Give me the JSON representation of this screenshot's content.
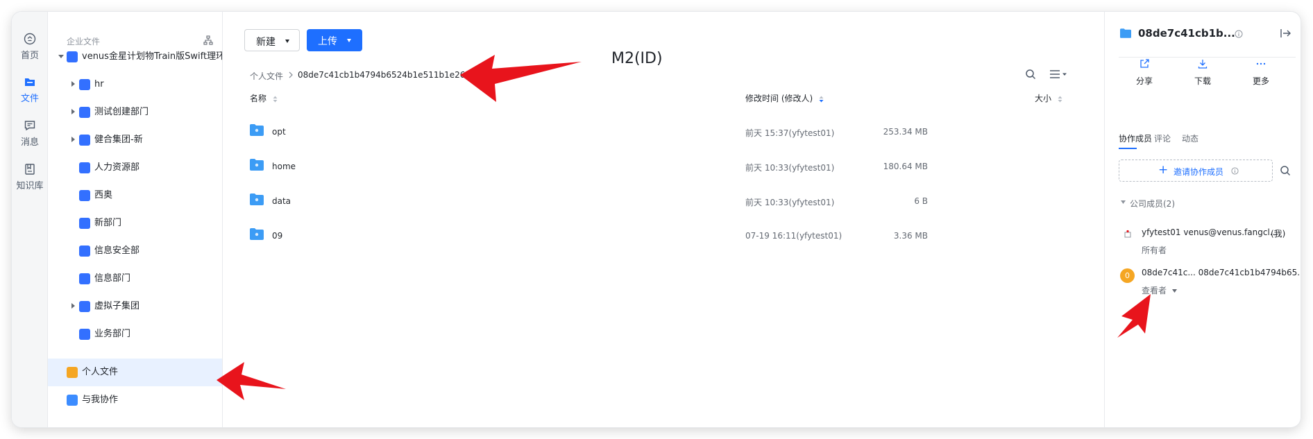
{
  "nav_rail": {
    "items": [
      {
        "label": "首页",
        "icon": "home-icon"
      },
      {
        "label": "文件",
        "icon": "files-icon",
        "active": true
      },
      {
        "label": "消息",
        "icon": "message-icon"
      },
      {
        "label": "知识库",
        "icon": "knowledge-base-icon"
      }
    ]
  },
  "tree": {
    "header": "企业文件",
    "items": [
      {
        "label": "venus金星计划物Train版Swift理环",
        "depth": 0,
        "expand": "down"
      },
      {
        "label": "hr",
        "depth": 1,
        "expand": "right"
      },
      {
        "label": "测试创建部门",
        "depth": 1,
        "expand": "right"
      },
      {
        "label": "健合集团-新",
        "depth": 1,
        "expand": "right"
      },
      {
        "label": "人力资源部",
        "depth": 1,
        "expand": "none"
      },
      {
        "label": "西奥",
        "depth": 1,
        "expand": "none"
      },
      {
        "label": "新部门",
        "depth": 1,
        "expand": "none"
      },
      {
        "label": "信息安全部",
        "depth": 1,
        "expand": "none"
      },
      {
        "label": "信息部门",
        "depth": 1,
        "expand": "none"
      },
      {
        "label": "虚拟子集团",
        "depth": 1,
        "expand": "right"
      },
      {
        "label": "业务部门",
        "depth": 1,
        "expand": "none"
      }
    ],
    "personal": "个人文件",
    "shared": "与我协作"
  },
  "toolbar": {
    "new_label": "新建",
    "upload_label": "上传"
  },
  "breadcrumb": {
    "root": "个人文件",
    "current": "08de7c41cb1b4794b6524b1e511b1e26"
  },
  "annotation": "M2(ID)",
  "table": {
    "headers": {
      "name": "名称",
      "modified": "修改时间 (修改人)",
      "size": "大小"
    },
    "rows": [
      {
        "name": "opt",
        "modified": "前天 15:37(yfytest01)",
        "size": "253.34 MB"
      },
      {
        "name": "home",
        "modified": "前天 10:33(yfytest01)",
        "size": "180.64 MB"
      },
      {
        "name": "data",
        "modified": "前天 10:33(yfytest01)",
        "size": "6 B"
      },
      {
        "name": "09",
        "modified": "07-19 16:11(yfytest01)",
        "size": "3.36 MB"
      }
    ]
  },
  "panel": {
    "title": "08de7c41cb1b...",
    "actions": [
      {
        "label": "分享",
        "icon": "share-icon"
      },
      {
        "label": "下载",
        "icon": "download-icon"
      },
      {
        "label": "更多",
        "icon": "more-icon"
      }
    ],
    "tabs": [
      "协作成员",
      "评论",
      "动态"
    ],
    "invite_label": "邀请协作成员",
    "group_title": "公司成员(2)",
    "members": [
      {
        "name": "yfytest01 venus@venus.fangcl...",
        "role": "所有者",
        "tag": "(我)"
      },
      {
        "name": "08de7c41c...  08de7c41cb1b4794b65...",
        "role": "查看者",
        "avatar": "0"
      }
    ]
  },
  "colors": {
    "accent": "#1e6fff",
    "folder": "#3c9cf5",
    "annotation_arrow": "#e8141c",
    "avatar_orange": "#f5a623"
  }
}
